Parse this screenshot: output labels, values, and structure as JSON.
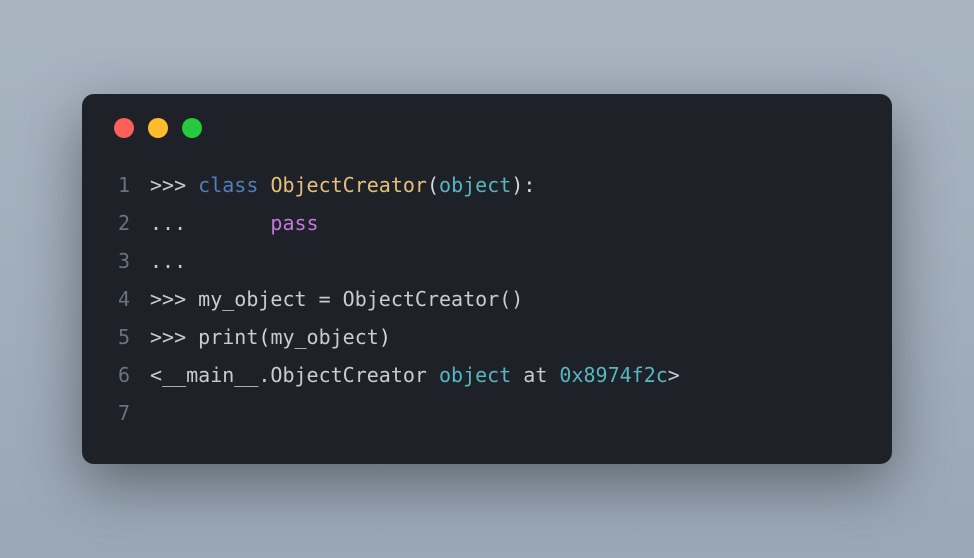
{
  "window": {
    "buttons": {
      "close": "close",
      "minimize": "minimize",
      "maximize": "maximize"
    }
  },
  "gutter": {
    "n1": "1",
    "n2": "2",
    "n3": "3",
    "n4": "4",
    "n5": "5",
    "n6": "6",
    "n7": "7"
  },
  "code": {
    "l1": {
      "p": ">>> ",
      "kw": "class",
      "sp1": " ",
      "cls": "ObjectCreator",
      "lp": "(",
      "obj": "object",
      "rp": ")",
      "colon": ":"
    },
    "l2": {
      "p": "...       ",
      "kw": "pass"
    },
    "l3": {
      "p": "... "
    },
    "l4": {
      "p": ""
    },
    "l5": {
      "p": ">>> ",
      "var": "my_object = ObjectCreator()"
    },
    "l6": {
      "p": ">>> ",
      "fn": "print",
      "lp": "(",
      "arg": "my_object",
      "rp": ")"
    },
    "l7": {
      "t1": "<__main__.ObjectCreator ",
      "obj": "object",
      "t2": " at ",
      "num": "0x8974f2c",
      "t3": ">"
    }
  }
}
